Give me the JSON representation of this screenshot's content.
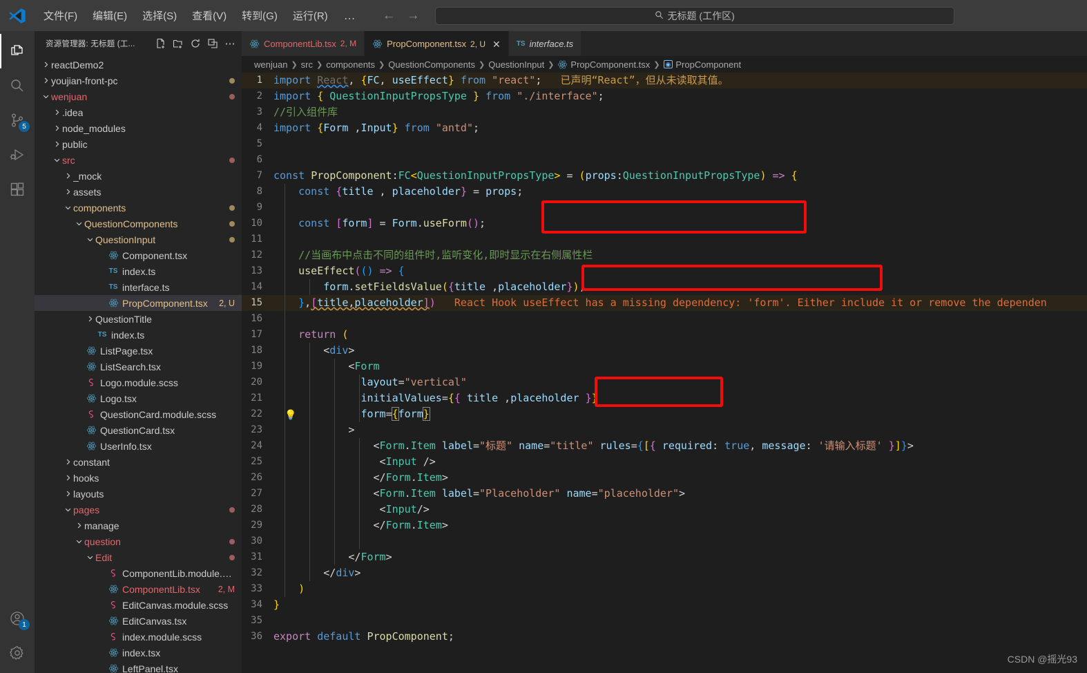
{
  "titlebar": {
    "logo_icon": "vscode-logo",
    "menus": [
      "文件(F)",
      "编辑(E)",
      "选择(S)",
      "查看(V)",
      "转到(G)",
      "运行(R)"
    ],
    "overflow_label": "…",
    "back_icon": "arrow-left-icon",
    "forward_icon": "arrow-right-icon",
    "quickinput": {
      "search_icon": "search-icon",
      "text": "无标题 (工作区)"
    }
  },
  "activitybar": {
    "items": [
      {
        "name": "explorer",
        "icon": "files-icon",
        "active": true,
        "badge": null
      },
      {
        "name": "search",
        "icon": "search-icon",
        "active": false,
        "badge": null
      },
      {
        "name": "source-control",
        "icon": "source-control-icon",
        "active": false,
        "badge": "5"
      },
      {
        "name": "run-and-debug",
        "icon": "debug-icon",
        "active": false,
        "badge": null
      },
      {
        "name": "extensions",
        "icon": "extensions-icon",
        "active": false,
        "badge": null
      }
    ],
    "bottom": [
      {
        "name": "accounts",
        "icon": "account-icon",
        "badge": "1"
      },
      {
        "name": "manage",
        "icon": "gear-icon",
        "badge": null
      }
    ]
  },
  "sidebar": {
    "title": "资源管理器: 无标题 (工...",
    "actions": [
      {
        "name": "new-file",
        "icon": "new-file-icon"
      },
      {
        "name": "new-folder",
        "icon": "new-folder-icon"
      },
      {
        "name": "refresh",
        "icon": "refresh-icon"
      },
      {
        "name": "collapse-all",
        "icon": "collapse-all-icon"
      },
      {
        "name": "more-actions",
        "icon": "ellipsis-icon"
      }
    ],
    "tree": [
      {
        "label": "reactDemo2",
        "indent": 0,
        "type": "folder",
        "expanded": false,
        "color": "default",
        "status": ""
      },
      {
        "label": "youjian-front-pc",
        "indent": 0,
        "type": "folder",
        "expanded": false,
        "color": "default",
        "status": "",
        "dot": "#a2895b"
      },
      {
        "label": "wenjuan",
        "indent": 0,
        "type": "folder",
        "expanded": true,
        "color": "conflict",
        "status": "",
        "dot": "#9d5c5e"
      },
      {
        "label": ".idea",
        "indent": 1,
        "type": "folder",
        "expanded": false,
        "color": "default",
        "status": ""
      },
      {
        "label": "node_modules",
        "indent": 1,
        "type": "folder",
        "expanded": false,
        "color": "default",
        "status": ""
      },
      {
        "label": "public",
        "indent": 1,
        "type": "folder",
        "expanded": false,
        "color": "default",
        "status": ""
      },
      {
        "label": "src",
        "indent": 1,
        "type": "folder",
        "expanded": true,
        "color": "conflict",
        "status": "",
        "dot": "#9d5c5e"
      },
      {
        "label": "_mock",
        "indent": 2,
        "type": "folder",
        "expanded": false,
        "color": "default",
        "status": ""
      },
      {
        "label": "assets",
        "indent": 2,
        "type": "folder",
        "expanded": false,
        "color": "default",
        "status": ""
      },
      {
        "label": "components",
        "indent": 2,
        "type": "folder",
        "expanded": true,
        "color": "mod",
        "status": "",
        "dot": "#a2895b"
      },
      {
        "label": "QuestionComponents",
        "indent": 3,
        "type": "folder",
        "expanded": true,
        "color": "mod",
        "status": "",
        "dot": "#a2895b"
      },
      {
        "label": "QuestionInput",
        "indent": 4,
        "type": "folder",
        "expanded": true,
        "color": "mod",
        "status": "",
        "dot": "#a2895b"
      },
      {
        "label": "Component.tsx",
        "indent": 5,
        "type": "react",
        "color": "default",
        "status": ""
      },
      {
        "label": "index.ts",
        "indent": 5,
        "type": "ts",
        "color": "default",
        "status": ""
      },
      {
        "label": "interface.ts",
        "indent": 5,
        "type": "ts",
        "color": "default",
        "status": ""
      },
      {
        "label": "PropComponent.tsx",
        "indent": 5,
        "type": "react",
        "color": "mod",
        "status": "2, U",
        "selected": true
      },
      {
        "label": "QuestionTitle",
        "indent": 4,
        "type": "folder",
        "expanded": false,
        "color": "default",
        "status": ""
      },
      {
        "label": "index.ts",
        "indent": 4,
        "type": "ts",
        "color": "default",
        "status": ""
      },
      {
        "label": "ListPage.tsx",
        "indent": 3,
        "type": "react",
        "color": "default",
        "status": ""
      },
      {
        "label": "ListSearch.tsx",
        "indent": 3,
        "type": "react",
        "color": "default",
        "status": ""
      },
      {
        "label": "Logo.module.scss",
        "indent": 3,
        "type": "scss",
        "color": "default",
        "status": ""
      },
      {
        "label": "Logo.tsx",
        "indent": 3,
        "type": "react",
        "color": "default",
        "status": ""
      },
      {
        "label": "QuestionCard.module.scss",
        "indent": 3,
        "type": "scss",
        "color": "default",
        "status": ""
      },
      {
        "label": "QuestionCard.tsx",
        "indent": 3,
        "type": "react",
        "color": "default",
        "status": ""
      },
      {
        "label": "UserInfo.tsx",
        "indent": 3,
        "type": "react",
        "color": "default",
        "status": ""
      },
      {
        "label": "constant",
        "indent": 2,
        "type": "folder",
        "expanded": false,
        "color": "default",
        "status": ""
      },
      {
        "label": "hooks",
        "indent": 2,
        "type": "folder",
        "expanded": false,
        "color": "default",
        "status": ""
      },
      {
        "label": "layouts",
        "indent": 2,
        "type": "folder",
        "expanded": false,
        "color": "default",
        "status": ""
      },
      {
        "label": "pages",
        "indent": 2,
        "type": "folder",
        "expanded": true,
        "color": "conflict",
        "status": "",
        "dot": "#9d5c5e"
      },
      {
        "label": "manage",
        "indent": 3,
        "type": "folder",
        "expanded": false,
        "color": "default",
        "status": ""
      },
      {
        "label": "question",
        "indent": 3,
        "type": "folder",
        "expanded": true,
        "color": "conflict",
        "status": "",
        "dot": "#9d5c5e"
      },
      {
        "label": "Edit",
        "indent": 4,
        "type": "folder",
        "expanded": true,
        "color": "conflict",
        "status": "",
        "dot": "#9d5c5e"
      },
      {
        "label": "ComponentLib.module.scss",
        "indent": 5,
        "type": "scss",
        "color": "default",
        "status": ""
      },
      {
        "label": "ComponentLib.tsx",
        "indent": 5,
        "type": "react",
        "color": "conflict",
        "status": "2, M"
      },
      {
        "label": "EditCanvas.module.scss",
        "indent": 5,
        "type": "scss",
        "color": "default",
        "status": ""
      },
      {
        "label": "EditCanvas.tsx",
        "indent": 5,
        "type": "react",
        "color": "default",
        "status": ""
      },
      {
        "label": "index.module.scss",
        "indent": 5,
        "type": "scss",
        "color": "default",
        "status": ""
      },
      {
        "label": "index.tsx",
        "indent": 5,
        "type": "react",
        "color": "default",
        "status": ""
      },
      {
        "label": "LeftPanel.tsx",
        "indent": 5,
        "type": "react",
        "color": "default",
        "status": ""
      }
    ]
  },
  "editor": {
    "tabs": [
      {
        "name": "ComponentLib.tsx",
        "icon": "react-icon",
        "status": "2, M",
        "active": false,
        "italic": false,
        "closable": false,
        "color": "#e4676b"
      },
      {
        "name": "PropComponent.tsx",
        "icon": "react-icon",
        "status": "2, U",
        "active": true,
        "italic": false,
        "closable": true,
        "close_icon": "close-icon",
        "color": "#e2c08d"
      },
      {
        "name": "interface.ts",
        "icon": "ts-icon",
        "status": "",
        "active": false,
        "italic": true,
        "closable": false,
        "color": "#cccccc"
      }
    ],
    "breadcrumbs": [
      "wenjuan",
      "src",
      "components",
      "QuestionComponents",
      "QuestionInput",
      "PropComponent.tsx",
      "PropComponent"
    ],
    "breadcrumb_file_icon": "react-icon",
    "breadcrumb_symbol_icon": "symbol-variable-icon",
    "line_count": 36,
    "inline_messages": {
      "line1_unused": "已声明“React”，但从未读取其值。",
      "line15_eslint": "React Hook useEffect has a missing dependency: 'form'. Either include it or remove the dependen"
    },
    "lightbulb_line": 22,
    "lightbulb_icon": "lightbulb-icon",
    "lines": [
      "import React, {FC, useEffect} from \"react\";",
      "import { QuestionInputPropsType } from \"./interface\";",
      "//引入组件库",
      "import {Form ,Input} from \"antd\";",
      "",
      "",
      "const PropComponent:FC<QuestionInputPropsType> = (props:QuestionInputPropsType) => {",
      "    const {title , placeholder} = props;",
      "",
      "    const [form] = Form.useForm();",
      "",
      "    //当画布中点击不同的组件时,监听变化,即时显示在右侧属性栏",
      "    useEffect(() => {",
      "        form.setFieldsValue({title ,placeholder});",
      "    },[title,placeholder])",
      "",
      "    return (",
      "        <div>",
      "            <Form",
      "              layout=\"vertical\"",
      "              initialValues={{ title ,placeholder }}",
      "              form={form}",
      "            >",
      "                <Form.Item label=\"标题\" name=\"title\" rules={[{ required: true, message: '请输入标题' }]}>",
      "                 <Input />",
      "                </Form.Item>",
      "                <Form.Item label=\"Placeholder\" name=\"placeholder\">",
      "                 <Input/>",
      "                </Form.Item>",
      "",
      "            </Form>",
      "        </div>",
      "    )",
      "}",
      "",
      "export default PropComponent;"
    ],
    "annotations": [
      {
        "name": "redbox-useform",
        "line": 10,
        "label": "const [form] = Form.useForm();"
      },
      {
        "name": "redbox-setfields",
        "line": 14,
        "label": "form.setFieldsValue({title ,placeholder});"
      },
      {
        "name": "redbox-form-prop",
        "line": 22,
        "label": "form={form}"
      }
    ]
  },
  "watermark": "CSDN @摇光93"
}
